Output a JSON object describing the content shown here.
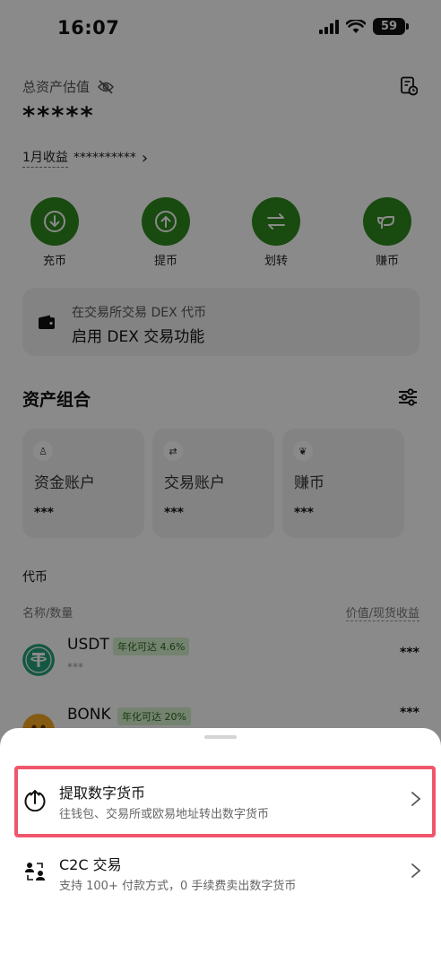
{
  "status_bar": {
    "time": "16:07",
    "battery": "59"
  },
  "assets": {
    "label": "总资产估值",
    "value": "*****",
    "monthly_label": "1月收益",
    "monthly_value": "**********",
    "monthly_chevron": "›"
  },
  "actions": [
    {
      "label": "充币",
      "icon": "deposit-icon"
    },
    {
      "label": "提币",
      "icon": "withdraw-icon"
    },
    {
      "label": "划转",
      "icon": "transfer-icon"
    },
    {
      "label": "赚币",
      "icon": "earn-icon"
    }
  ],
  "dex": {
    "line1": "在交易所交易 DEX 代币",
    "line2": "启用 DEX 交易功能"
  },
  "portfolio": {
    "title": "资产组合",
    "accounts": [
      {
        "name": "资金账户",
        "value": "***",
        "icon_glyph": "♙"
      },
      {
        "name": "交易账户",
        "value": "***",
        "icon_glyph": "⇄"
      },
      {
        "name": "赚币",
        "value": "***",
        "icon_glyph": "❦"
      }
    ]
  },
  "tokens": {
    "title": "代币",
    "col_left": "名称/数量",
    "col_right": "价值/现货收益",
    "items": [
      {
        "symbol": "USDT",
        "tag": "年化可达 4.6%",
        "amount": "***",
        "value": "***",
        "color": "#26a17b"
      },
      {
        "symbol": "BONK",
        "tag": "年化可达 20%",
        "amount": "***",
        "value": "***",
        "color": "#f5a623"
      }
    ]
  },
  "sheet": {
    "options": [
      {
        "title": "提取数字货币",
        "subtitle": "往钱包、交易所或欧易地址转出数字货币"
      },
      {
        "title": "C2C 交易",
        "subtitle": "支持 100+ 付款方式，0 手续费卖出数字货币"
      }
    ]
  },
  "colors": {
    "accent_green": "#2f8a1f",
    "highlight": "#f0566b"
  }
}
